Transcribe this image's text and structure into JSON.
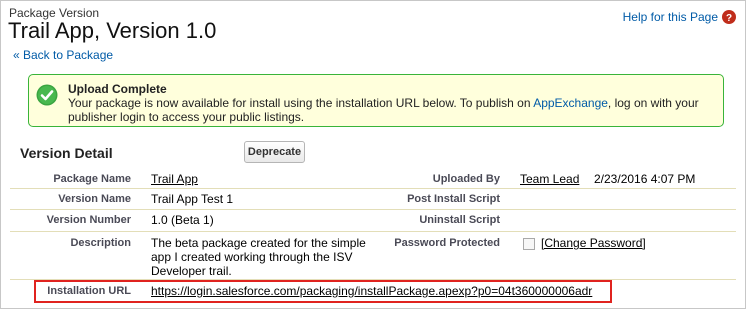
{
  "header": {
    "label": "Package Version",
    "title": "Trail App, Version 1.0",
    "help_link": "Help for this Page",
    "back_link": "« Back to Package"
  },
  "message": {
    "title": "Upload Complete",
    "text_before_link": "Your package is now available for install using the installation URL below. To publish on ",
    "link": "AppExchange",
    "text_after_link": ", log on with your publisher login to access your public listings."
  },
  "version_detail": {
    "title": "Version Detail",
    "deprecate_label": "Deprecate",
    "package_name_label": "Package Name",
    "package_name": "Trail App",
    "uploaded_by_label": "Uploaded By",
    "uploaded_by": "Team Lead",
    "uploaded_date": "2/23/2016 4:07 PM",
    "version_name_label": "Version Name",
    "version_name": "Trail App Test 1",
    "post_install_label": "Post Install Script",
    "post_install": "",
    "version_number_label": "Version Number",
    "version_number": "1.0 (Beta 1)",
    "uninstall_label": "Uninstall Script",
    "uninstall": "",
    "description_label": "Description",
    "description": "The beta package created for the simple app I created working through the ISV Developer trail.",
    "password_label": "Password Protected",
    "password_protected": false,
    "change_password": "[Change Password]",
    "installation_url_label": "Installation URL",
    "installation_url": "https://login.salesforce.com/packaging/installPackage.apexp?p0=04t360000006adr"
  },
  "colors": {
    "link": "#015ba7",
    "success_border": "#39b439",
    "message_bg": "#ffffdc",
    "highlight_box": "#e0231f"
  }
}
